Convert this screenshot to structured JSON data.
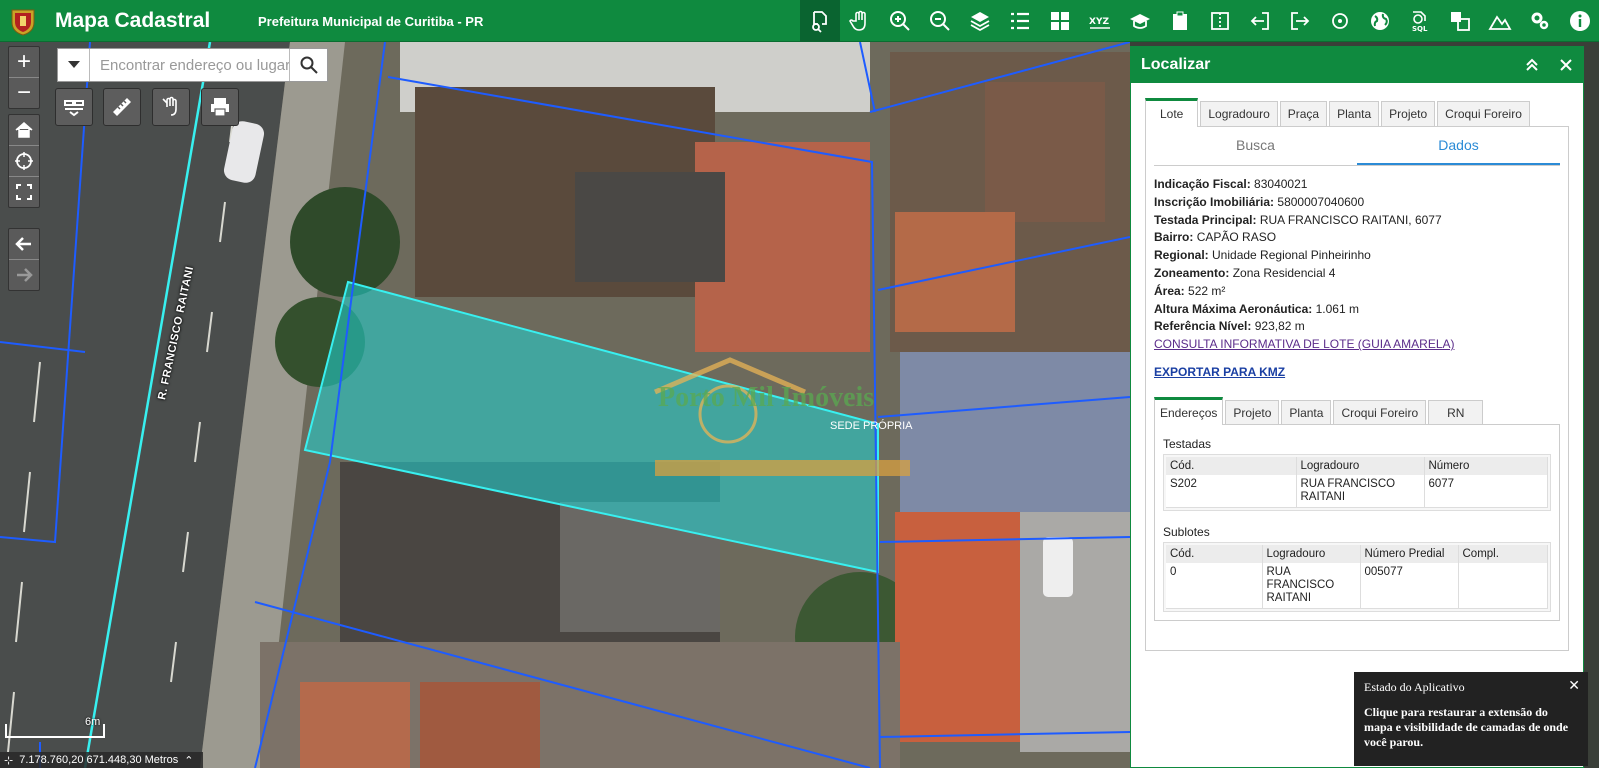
{
  "header": {
    "title": "Mapa Cadastral",
    "subtitle": "Prefeitura Municipal de Curitiba - PR",
    "tools": [
      "identify-icon",
      "hand-icon",
      "zoom-in-icon",
      "zoom-out-icon",
      "layers-icon",
      "list-icon",
      "grid-icon",
      "xyz-icon",
      "graduation-icon",
      "paste-icon",
      "split-icon",
      "import-icon",
      "export-icon",
      "locate-icon",
      "globe-icon",
      "sql-icon",
      "compare-icon",
      "measure-terrain-icon",
      "settings-icon",
      "info-icon"
    ]
  },
  "search": {
    "placeholder": "Encontrar endereço ou lugar"
  },
  "map": {
    "street_label": "R. FRANCISCO RAITANI",
    "scale_label": "6m",
    "coordinates": "7.178.760,20 671.448,30 Metros",
    "watermark": {
      "line1": "Porto Mil Imóveis",
      "line2": "SEDE PRÓPRIA"
    }
  },
  "panel": {
    "title": "Localizar",
    "tabs": [
      "Lote",
      "Logradouro",
      "Praça",
      "Planta",
      "Projeto",
      "Croqui Foreiro"
    ],
    "subtabs": [
      "Busca",
      "Dados"
    ],
    "fields": [
      {
        "label": "Indicação Fiscal:",
        "value": "83040021"
      },
      {
        "label": "Inscrição Imobiliária:",
        "value": "5800007040600"
      },
      {
        "label": "Testada Principal:",
        "value": "RUA FRANCISCO RAITANI, 6077"
      },
      {
        "label": "Bairro:",
        "value": "CAPÃO RASO"
      },
      {
        "label": "Regional:",
        "value": "Unidade Regional Pinheirinho"
      },
      {
        "label": "Zoneamento:",
        "value": "Zona Residencial 4"
      },
      {
        "label": "Área:",
        "value": "522 m²"
      },
      {
        "label": "Altura Máxima Aeronáutica:",
        "value": "1.061 m"
      },
      {
        "label": "Referência Nível:",
        "value": "923,82 m"
      }
    ],
    "link_guia": "CONSULTA INFORMATIVA DE LOTE (GUIA AMARELA)",
    "link_kmz": "EXPORTAR PARA KMZ",
    "inner_tabs": [
      "Endereços",
      "Projeto",
      "Planta",
      "Croqui Foreiro",
      "RN"
    ],
    "testadas": {
      "title": "Testadas",
      "headers": [
        "Cód.",
        "Logradouro",
        "Número"
      ],
      "rows": [
        [
          "S202",
          "RUA FRANCISCO RAITANI",
          "6077"
        ]
      ]
    },
    "sublotes": {
      "title": "Sublotes",
      "headers": [
        "Cód.",
        "Logradouro",
        "Número Predial",
        "Compl."
      ],
      "rows": [
        [
          "0",
          "RUA FRANCISCO RAITANI",
          "005077",
          ""
        ]
      ]
    }
  },
  "toast": {
    "title": "Estado do Aplicativo",
    "message": "Clique para restaurar a extensão do mapa e visibilidade de camadas de onde você parou."
  },
  "colors": {
    "header": "#0f8a3f",
    "parcel_line": "#1e5cff",
    "selected_fill": "#1fd6d6",
    "tab_active": "#2b8bd6"
  }
}
